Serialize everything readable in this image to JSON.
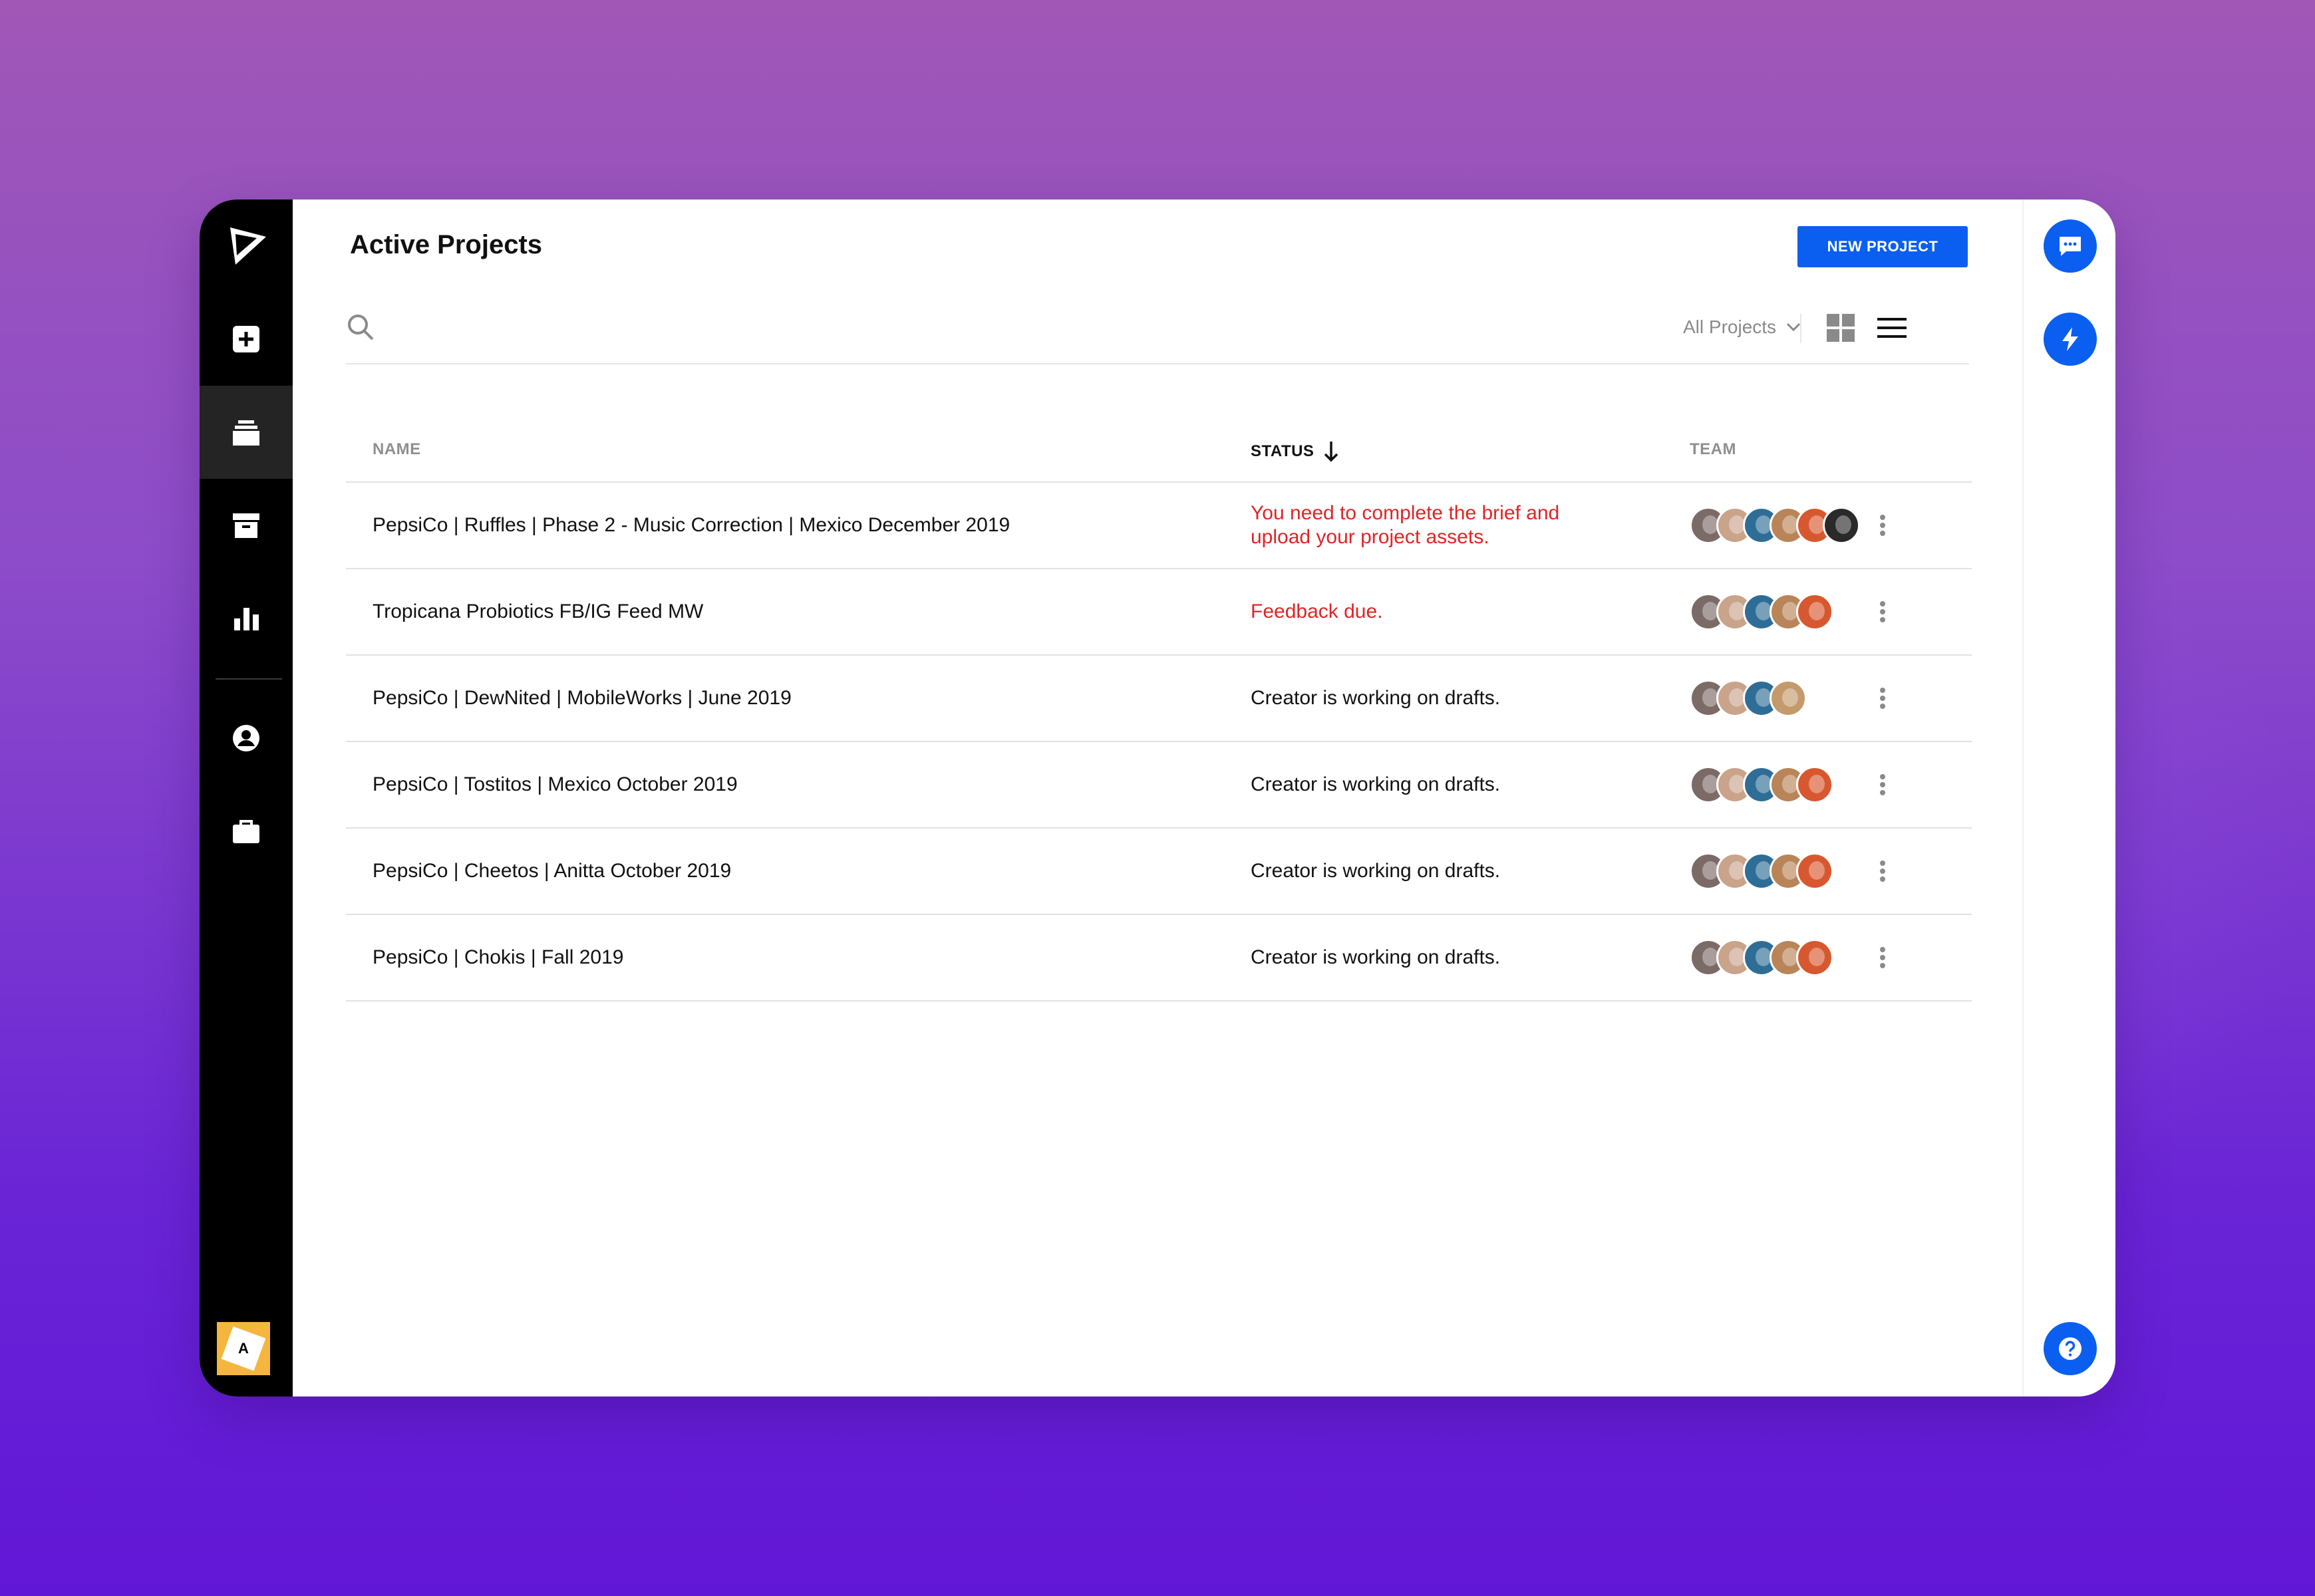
{
  "colors": {
    "accent": "#0a5ff0",
    "alert": "#e02424",
    "nav_bg": "#000000"
  },
  "sidebar": {
    "logo": "send-logo-icon",
    "items": [
      {
        "icon": "add-project-icon"
      },
      {
        "icon": "projects-stack-icon",
        "active": true
      },
      {
        "icon": "archive-icon"
      },
      {
        "icon": "analytics-icon"
      },
      {
        "icon": "account-icon"
      },
      {
        "icon": "briefcase-icon"
      }
    ],
    "workspace_letter": "A"
  },
  "header": {
    "title": "Active Projects",
    "new_button": "NEW PROJECT"
  },
  "toolbar": {
    "filter_label": "All Projects"
  },
  "table": {
    "columns": {
      "name": "NAME",
      "status": "STATUS",
      "team": "TEAM"
    },
    "rows": [
      {
        "name": "PepsiCo | Ruffles | Phase 2 - Music Correction | Mexico December 2019",
        "status": "You need to complete the brief and upload your project assets.",
        "alert": true,
        "team": [
          "#7b6a66",
          "#c9a38a",
          "#2e6d96",
          "#b88458",
          "#d7582f",
          "#2a2a2a"
        ]
      },
      {
        "name": "Tropicana Probiotics FB/IG Feed MW",
        "status": "Feedback due.",
        "alert": true,
        "team": [
          "#7b6a66",
          "#c9a38a",
          "#2e6d96",
          "#b88458",
          "#d7582f"
        ]
      },
      {
        "name": "PepsiCo | DewNited | MobileWorks | June 2019",
        "status": "Creator is working on drafts.",
        "alert": false,
        "team": [
          "#7b6a66",
          "#c9a38a",
          "#2e6d96",
          "#c49a6c"
        ]
      },
      {
        "name": "PepsiCo | Tostitos | Mexico October 2019",
        "status": "Creator is working on drafts.",
        "alert": false,
        "team": [
          "#7b6a66",
          "#c9a38a",
          "#2e6d96",
          "#b88458",
          "#d7582f"
        ]
      },
      {
        "name": "PepsiCo | Cheetos | Anitta October 2019",
        "status": "Creator is working on drafts.",
        "alert": false,
        "team": [
          "#7b6a66",
          "#c9a38a",
          "#2e6d96",
          "#b88458",
          "#d7582f"
        ]
      },
      {
        "name": "PepsiCo | Chokis | Fall 2019",
        "status": "Creator is working on drafts.",
        "alert": false,
        "team": [
          "#7b6a66",
          "#c9a38a",
          "#2e6d96",
          "#b88458",
          "#d7582f"
        ]
      }
    ]
  },
  "rail": {
    "buttons": [
      "chat-icon",
      "lightning-icon",
      "help-icon"
    ]
  }
}
